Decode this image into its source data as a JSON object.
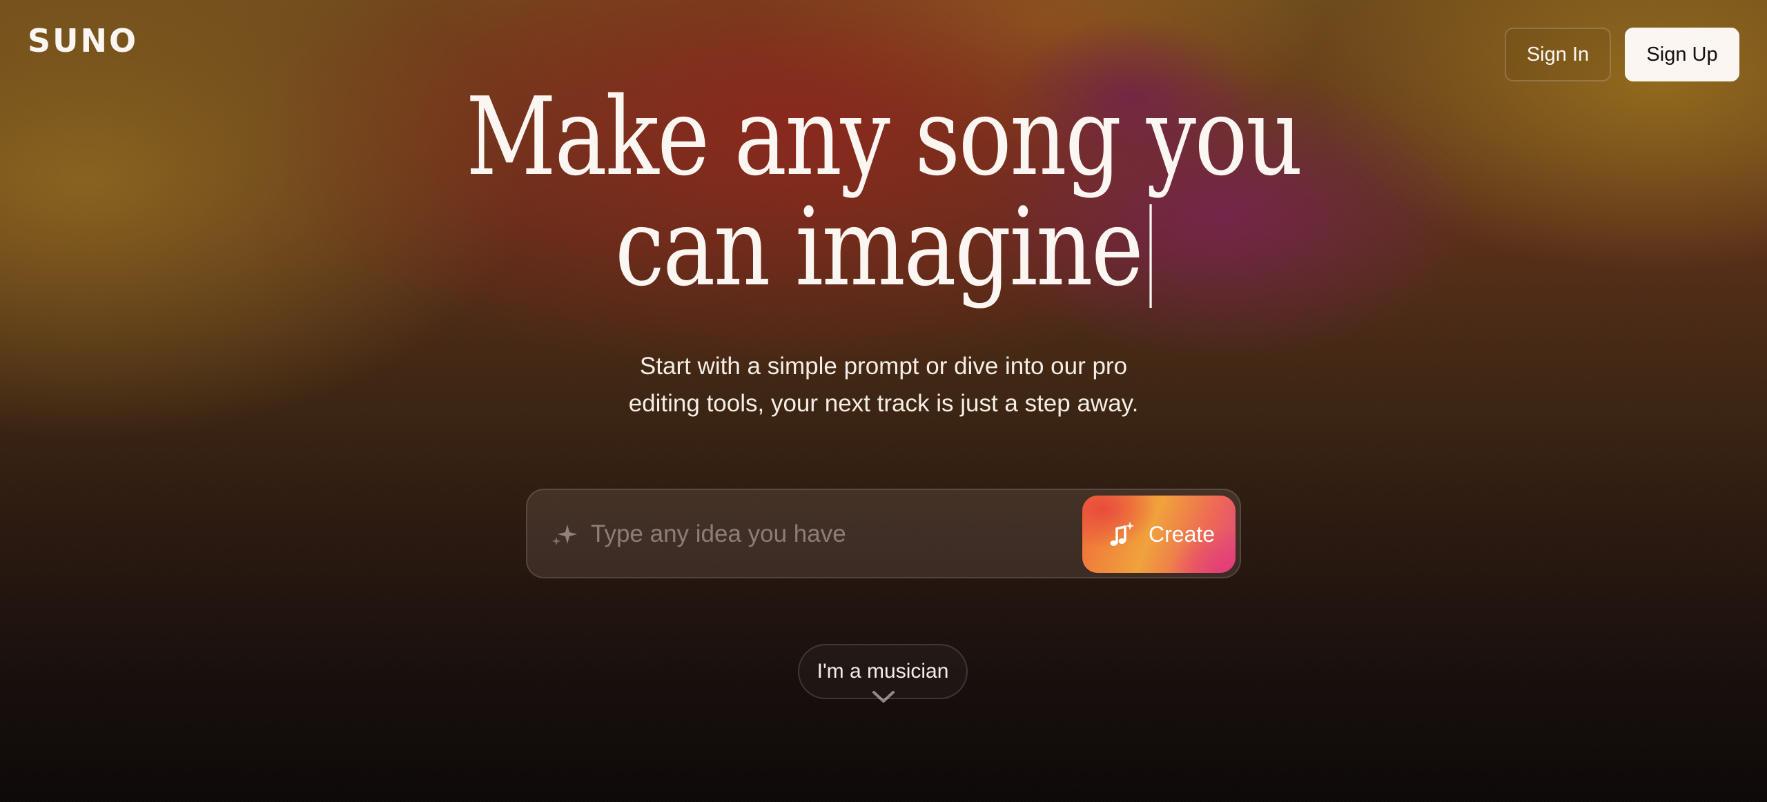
{
  "header": {
    "logo_text": "SUNO",
    "sign_in_label": "Sign In",
    "sign_up_label": "Sign Up"
  },
  "hero": {
    "headline_line1": "Make any song you",
    "headline_line2": "can imagine",
    "subtitle_line1": "Start with a simple prompt or dive into our pro",
    "subtitle_line2": "editing tools, your next track is just a step away."
  },
  "prompt": {
    "placeholder": "Type any idea you have",
    "value": "",
    "leading_icon": "sparkle-icon",
    "create_label": "Create",
    "create_icon": "music-note-plus-icon"
  },
  "musician": {
    "label": "I'm a musician",
    "icon": "chevron-down-icon"
  },
  "colors": {
    "text": "#fbf6f1",
    "sign_up_bg": "#fbf6f1",
    "create_gradient_start": "#ef6a3a",
    "create_gradient_end": "#e04a7c"
  }
}
